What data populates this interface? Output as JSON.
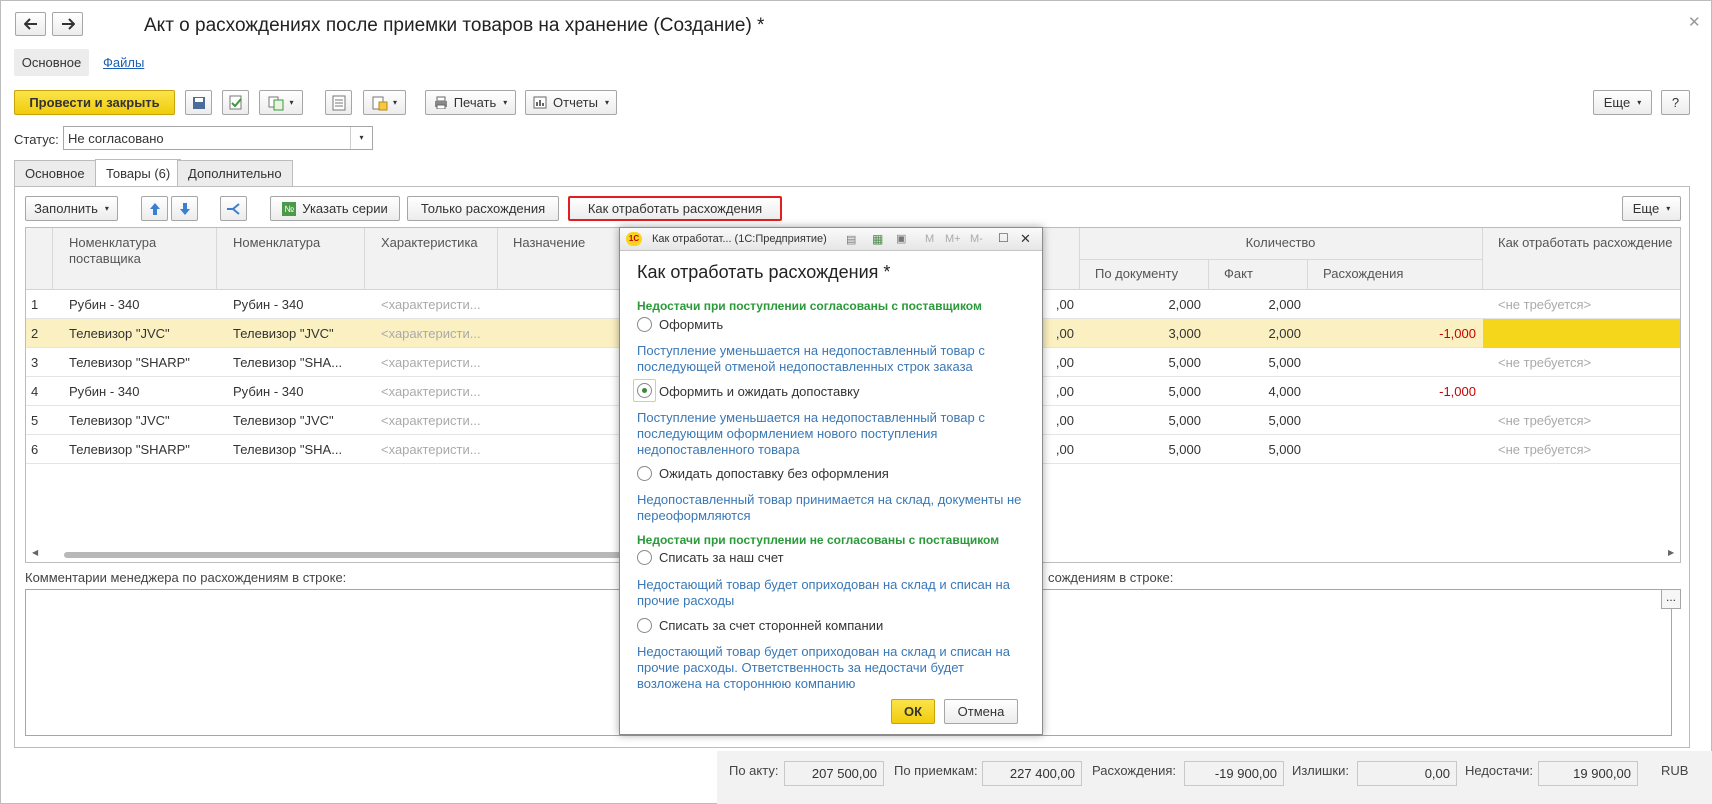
{
  "window": {
    "title": "Акт о расхождениях после приемки товаров на хранение (Создание) *"
  },
  "nav_tabs": [
    {
      "label": "Основное"
    },
    {
      "label": "Файлы"
    }
  ],
  "toolbar": {
    "post_close": "Провести и закрыть",
    "print": "Печать",
    "reports": "Отчеты",
    "more": "Еще",
    "help": "?"
  },
  "status": {
    "label": "Статус:",
    "value": "Не согласовано"
  },
  "doc_tabs": [
    {
      "label": "Основное"
    },
    {
      "label": "Товары (6)"
    },
    {
      "label": "Дополнительно"
    }
  ],
  "goods_toolbar": {
    "fill": "Заполнить",
    "series": "Указать серии",
    "only_diff": "Только расхождения",
    "how_to": "Как отработать расхождения",
    "more": "Еще"
  },
  "table": {
    "headers": {
      "nom_supplier": "Номенклатура поставщика",
      "nom": "Номенклатура",
      "char": "Характеристика",
      "dest": "Назначение",
      "qty_group": "Количество",
      "by_doc": "По документу",
      "fact": "Факт",
      "diff": "Расхождения",
      "how": "Как отработать расхождение"
    },
    "rows": [
      {
        "n": "1",
        "supplier": "Рубин - 340",
        "nom": "Рубин - 340",
        "char": "<характеристи...",
        "price": ",00",
        "by_doc": "2,000",
        "fact": "2,000",
        "diff": "",
        "how": "<не требуется>"
      },
      {
        "n": "2",
        "supplier": "Телевизор \"JVC\"",
        "nom": "Телевизор \"JVC\"",
        "char": "<характеристи...",
        "price": ",00",
        "by_doc": "3,000",
        "fact": "2,000",
        "diff": "-1,000",
        "how": ""
      },
      {
        "n": "3",
        "supplier": "Телевизор \"SHARP\"",
        "nom": "Телевизор \"SHA...",
        "char": "<характеристи...",
        "price": ",00",
        "by_doc": "5,000",
        "fact": "5,000",
        "diff": "",
        "how": "<не требуется>"
      },
      {
        "n": "4",
        "supplier": "Рубин - 340",
        "nom": "Рубин - 340",
        "char": "<характеристи...",
        "price": ",00",
        "by_doc": "5,000",
        "fact": "4,000",
        "diff": "-1,000",
        "how": ""
      },
      {
        "n": "5",
        "supplier": "Телевизор \"JVC\"",
        "nom": "Телевизор \"JVC\"",
        "char": "<характеристи...",
        "price": ",00",
        "by_doc": "5,000",
        "fact": "5,000",
        "diff": "",
        "how": "<не требуется>"
      },
      {
        "n": "6",
        "supplier": "Телевизор \"SHARP\"",
        "nom": "Телевизор \"SHA...",
        "char": "<характеристи...",
        "price": ",00",
        "by_doc": "5,000",
        "fact": "5,000",
        "diff": "",
        "how": "<не требуется>"
      }
    ]
  },
  "comments": {
    "manager_label": "Комментарии менеджера по расхождениям в строке:",
    "right_label": "сождениям в строке:"
  },
  "totals": {
    "by_act_label": "По акту:",
    "by_act": "207 500,00",
    "by_receipts_label": "По приемкам:",
    "by_receipts": "227 400,00",
    "diff_label": "Расхождения:",
    "diff": "-19 900,00",
    "surplus_label": "Излишки:",
    "surplus": "0,00",
    "shortage_label": "Недостачи:",
    "shortage": "19 900,00",
    "currency": "RUB"
  },
  "dialog": {
    "titlebar": "Как отработат... (1С:Предприятие)",
    "titlebar_letters": [
      "M",
      "M+",
      "M-"
    ],
    "heading": "Как отработать расхождения *",
    "group1": "Недостачи при поступлении согласованы с поставщиком",
    "opt1": "Оформить",
    "desc1": "Поступление уменьшается на недопоставленный товар с последующей отменой недопоставленных строк заказа",
    "opt2": "Оформить и ожидать допоставку",
    "desc2": "Поступление уменьшается на недопоставленный товар с последующим оформлением нового поступления недопоставленного товара",
    "opt3": "Ожидать допоставку без оформления",
    "desc3": "Недопоставленный товар принимается на склад, документы не переоформляются",
    "group2": "Недостачи при поступлении не согласованы с поставщиком",
    "opt4": "Списать за наш счет",
    "desc4": "Недостающий товар будет оприходован на склад и списан на прочие расходы",
    "opt5": "Списать за счет сторонней компании",
    "desc5": "Недостающий товар будет оприходован на склад и списан на прочие расходы. Ответственность за недостачи будет возложена на стороннюю компанию",
    "ok": "ОК",
    "cancel": "Отмена"
  },
  "colors": {
    "accent_yellow": "#f5d61a",
    "row_highlight": "#fbf0c1",
    "red_frame": "#e02020",
    "green_group": "#2a9a3a",
    "link_blue": "#3a78b6"
  }
}
